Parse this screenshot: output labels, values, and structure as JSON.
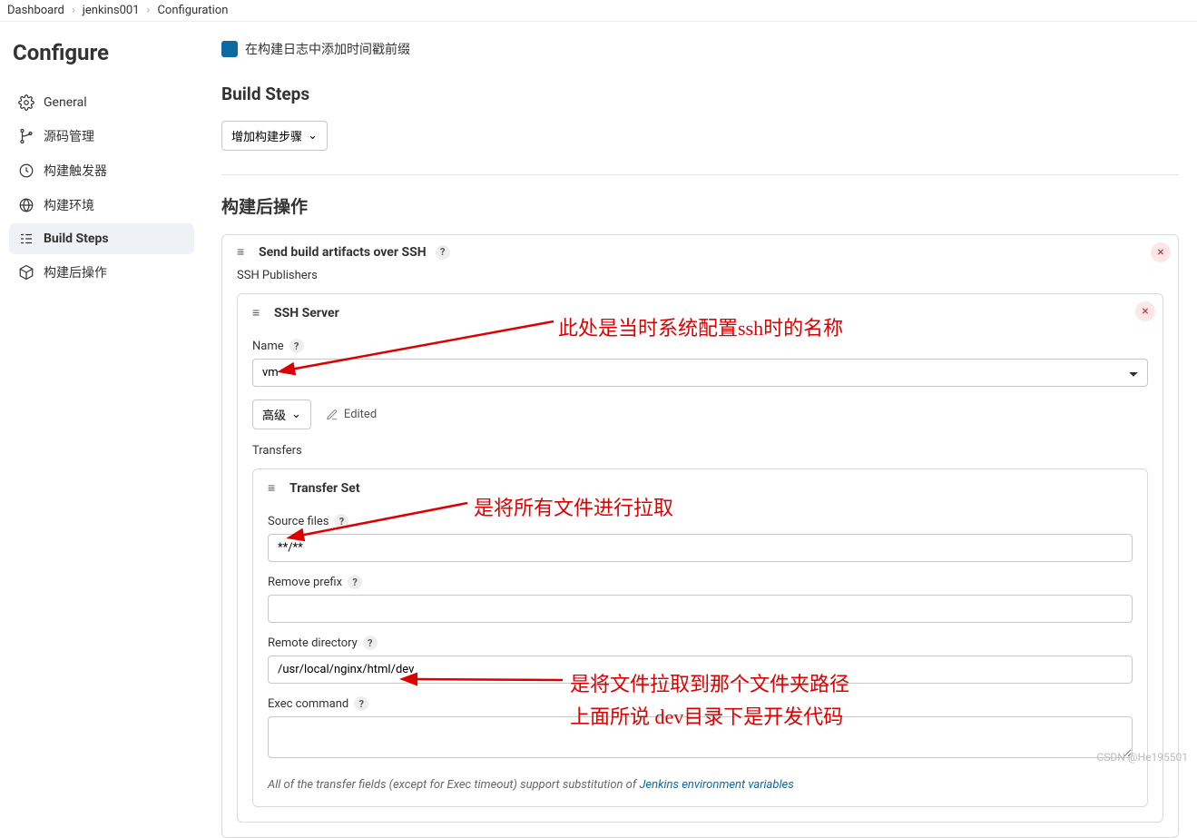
{
  "breadcrumb": {
    "dashboard": "Dashboard",
    "job": "jenkins001",
    "page": "Configuration"
  },
  "sidebar": {
    "title": "Configure",
    "items": [
      {
        "label": "General"
      },
      {
        "label": "源码管理"
      },
      {
        "label": "构建触发器"
      },
      {
        "label": "构建环境"
      },
      {
        "label": "Build Steps"
      },
      {
        "label": "构建后操作"
      }
    ]
  },
  "truncated_row": "在构建日志中添加时间戳前缀",
  "build_steps_title": "Build Steps",
  "add_step_label": "增加构建步骤",
  "post_build_title": "构建后操作",
  "ssh_panel": {
    "title": "Send build artifacts over SSH",
    "subtitle": "SSH Publishers",
    "server_title": "SSH Server",
    "name_label": "Name",
    "name_value": "vm",
    "advanced_label": "高级",
    "edited_label": "Edited",
    "transfers_label": "Transfers",
    "transfer_set_title": "Transfer Set",
    "source_files_label": "Source files",
    "source_files_value": "**/**",
    "remove_prefix_label": "Remove prefix",
    "remove_prefix_value": "",
    "remote_dir_label": "Remote directory",
    "remote_dir_value": "/usr/local/nginx/html/dev",
    "exec_command_label": "Exec command",
    "exec_command_value": "",
    "note_prefix": "All of the transfer fields (except for Exec timeout) support substitution of ",
    "note_link": "Jenkins environment variables"
  },
  "annotations": {
    "ssh_name": "此处是当时系统配置ssh时的名称",
    "pull_all": "是将所有文件进行拉取",
    "target_path1": "是将文件拉取到那个文件夹路径",
    "target_path2": "上面所说 dev目录下是开发代码"
  },
  "watermark": "CSDN @He195501"
}
